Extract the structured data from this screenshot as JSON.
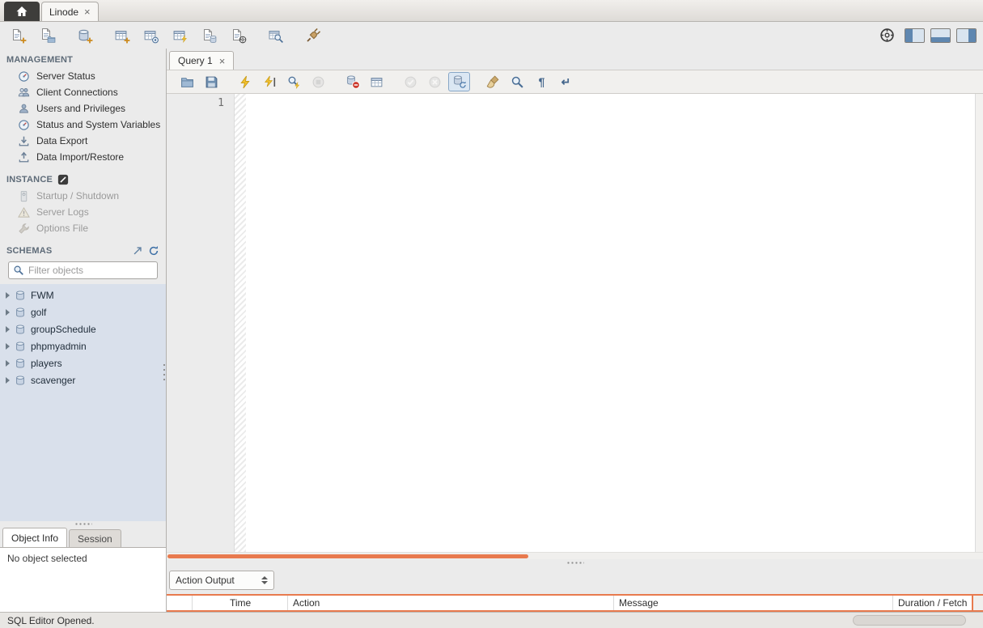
{
  "colors": {
    "accent_orange": "#e87a4e",
    "schema_panel_bg": "#d9e0eb",
    "selection_blue": "#5f87b0",
    "window_bg": "#ebebeb"
  },
  "window": {
    "connection_tab_label": "Linode",
    "close_glyph": "×"
  },
  "main_toolbar": {
    "left_icons": [
      "new-query-tab",
      "open-sql-script",
      "create-schema",
      "create-table",
      "create-view",
      "create-routine",
      "create-procedure",
      "create-function",
      "search-table-data",
      "reconnect-dbms"
    ],
    "right_icons": [
      "preferences",
      "toggle-sidebar",
      "toggle-output-area",
      "toggle-secondary-sidebar"
    ]
  },
  "sidebar": {
    "management": {
      "title": "MANAGEMENT",
      "items": [
        {
          "label": "Server Status",
          "icon": "gauge-icon"
        },
        {
          "label": "Client Connections",
          "icon": "connections-icon"
        },
        {
          "label": "Users and Privileges",
          "icon": "user-icon"
        },
        {
          "label": "Status and System Variables",
          "icon": "variables-icon"
        },
        {
          "label": "Data Export",
          "icon": "export-icon"
        },
        {
          "label": "Data Import/Restore",
          "icon": "import-icon"
        }
      ]
    },
    "instance": {
      "title": "INSTANCE",
      "items": [
        {
          "label": "Startup / Shutdown",
          "icon": "power-icon",
          "disabled": true
        },
        {
          "label": "Server Logs",
          "icon": "logs-icon",
          "disabled": true
        },
        {
          "label": "Options File",
          "icon": "wrench-icon",
          "disabled": true
        }
      ]
    },
    "schemas": {
      "title": "SCHEMAS",
      "filter_placeholder": "Filter objects",
      "items": [
        "FWM",
        "golf",
        "groupSchedule",
        "phpmyadmin",
        "players",
        "scavenger"
      ]
    },
    "bottom_tabs": [
      {
        "label": "Object Info",
        "active": true
      },
      {
        "label": "Session",
        "active": false
      }
    ],
    "object_info_text": "No object selected"
  },
  "editor": {
    "tab_label": "Query 1",
    "close_glyph": "×",
    "first_line_number": "1"
  },
  "editor_toolbar": {
    "icons": [
      "open-script",
      "save-script",
      "execute",
      "execute-current",
      "explain",
      "stop",
      "toggle-stop-on-error",
      "limit-rows",
      "commit",
      "rollback",
      "toggle-autocommit",
      "beautify",
      "find",
      "toggle-invisible-chars",
      "toggle-wrap"
    ]
  },
  "output": {
    "selector_value": "Action Output",
    "columns": [
      "Time",
      "Action",
      "Message",
      "Duration / Fetch"
    ]
  },
  "statusbar": {
    "text": "SQL Editor Opened."
  }
}
